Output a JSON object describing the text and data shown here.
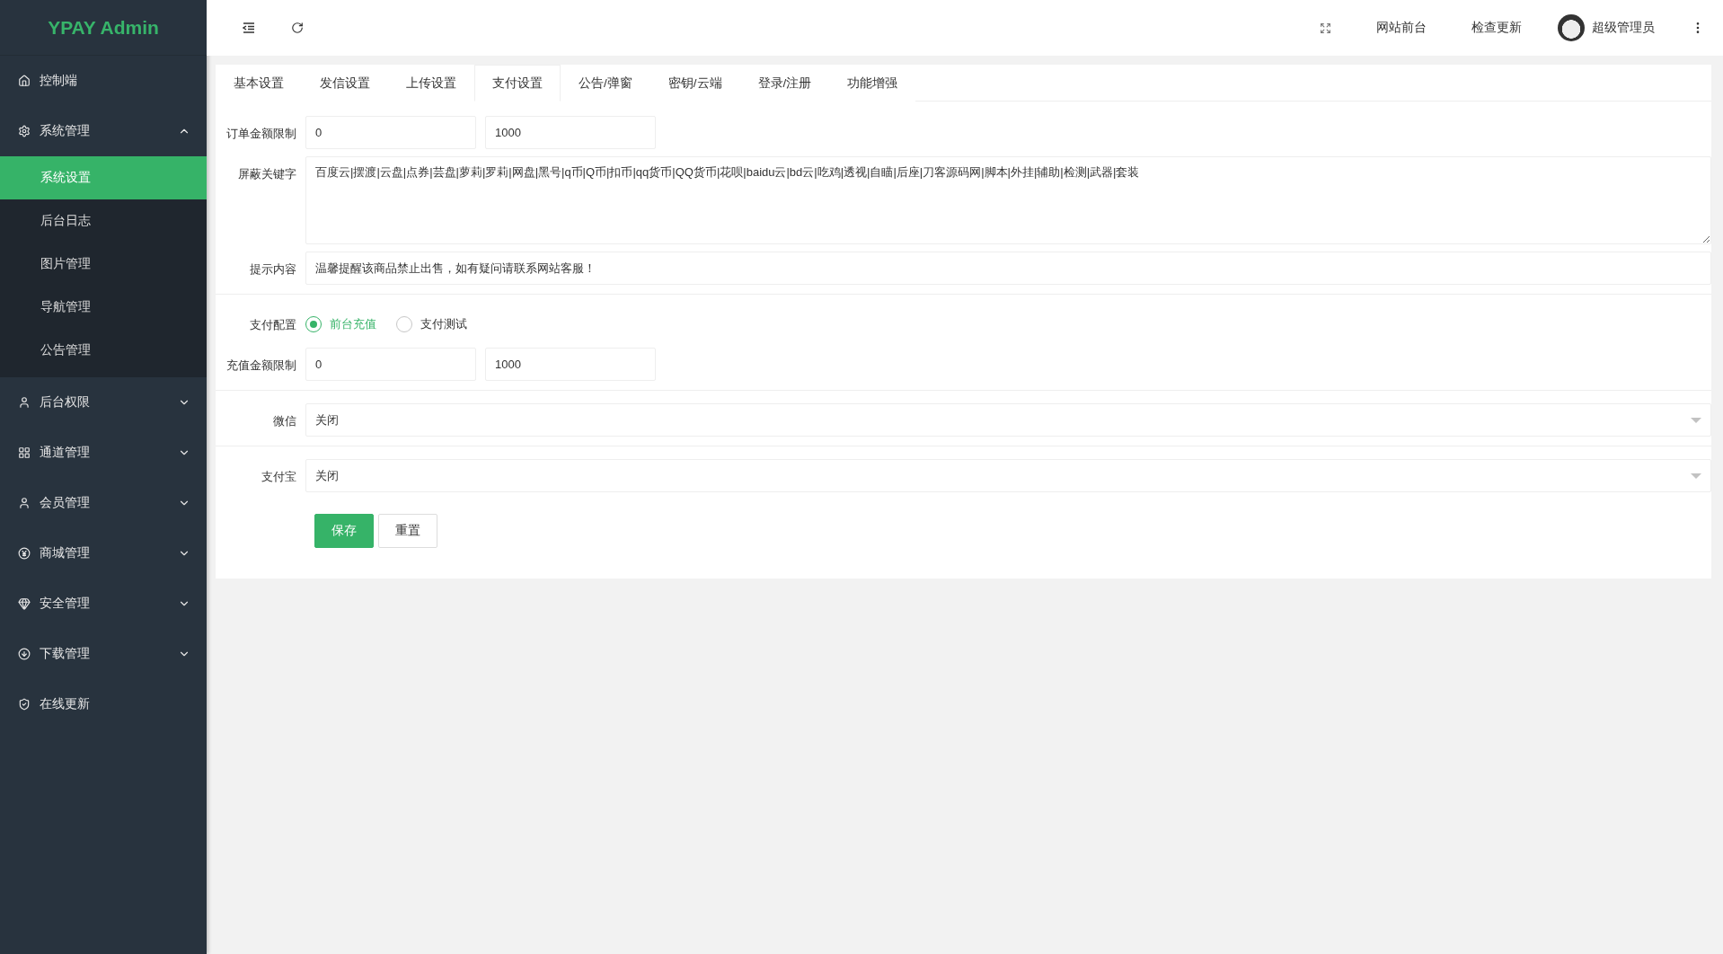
{
  "logo": "YPAY Admin",
  "sidebar": {
    "items": [
      {
        "kind": "link",
        "label": "控制端"
      },
      {
        "kind": "group",
        "label": "系统管理",
        "expanded": true,
        "children": [
          {
            "label": "系统设置",
            "selected": true
          },
          {
            "label": "后台日志",
            "selected": false
          },
          {
            "label": "图片管理",
            "selected": false
          },
          {
            "label": "导航管理",
            "selected": false
          },
          {
            "label": "公告管理",
            "selected": false
          }
        ]
      },
      {
        "kind": "group",
        "label": "后台权限",
        "expanded": false
      },
      {
        "kind": "group",
        "label": "通道管理",
        "expanded": false
      },
      {
        "kind": "group",
        "label": "会员管理",
        "expanded": false
      },
      {
        "kind": "group",
        "label": "商城管理",
        "expanded": false
      },
      {
        "kind": "group",
        "label": "安全管理",
        "expanded": false
      },
      {
        "kind": "group",
        "label": "下载管理",
        "expanded": false
      },
      {
        "kind": "link",
        "label": "在线更新"
      }
    ]
  },
  "header": {
    "links": [
      "网站前台",
      "检查更新"
    ],
    "user": "超级管理员"
  },
  "tabs": [
    {
      "label": "基本设置",
      "selected": false
    },
    {
      "label": "发信设置",
      "selected": false
    },
    {
      "label": "上传设置",
      "selected": false
    },
    {
      "label": "支付设置",
      "selected": true
    },
    {
      "label": "公告/弹窗",
      "selected": false
    },
    {
      "label": "密钥/云端",
      "selected": false
    },
    {
      "label": "登录/注册",
      "selected": false
    },
    {
      "label": "功能增强",
      "selected": false
    }
  ],
  "form": {
    "sections": [
      {
        "rows": [
          {
            "kind": "range",
            "label": "订单金额限制",
            "values": [
              "0",
              "1000"
            ]
          },
          {
            "kind": "textarea",
            "label": "屏蔽关键字",
            "value": "百度云|摆渡|云盘|点券|芸盘|萝莉|罗莉|网盘|黑号|q币|Q币|扣币|qq货币|QQ货币|花呗|baidu云|bd云|吃鸡|透视|自瞄|后座|刀客源码网|脚本|外挂|辅助|检测|武器|套装"
          },
          {
            "kind": "text",
            "label": "提示内容",
            "value": "温馨提醒该商品禁止出售，如有疑问请联系网站客服！"
          }
        ]
      },
      {
        "rows": [
          {
            "kind": "radio",
            "label": "支付配置",
            "options": [
              {
                "label": "前台充值",
                "selected": true
              },
              {
                "label": "支付测试",
                "selected": false
              }
            ]
          },
          {
            "kind": "range",
            "label": "充值金额限制",
            "values": [
              "0",
              "1000"
            ]
          }
        ]
      },
      {
        "rows": [
          {
            "kind": "select",
            "label": "微信",
            "value": "关闭"
          }
        ]
      },
      {
        "rows": [
          {
            "kind": "select",
            "label": "支付宝",
            "value": "关闭"
          }
        ]
      }
    ],
    "buttons": [
      {
        "kind": "primary",
        "label": "保存"
      },
      {
        "kind": "plain",
        "label": "重置"
      }
    ]
  }
}
